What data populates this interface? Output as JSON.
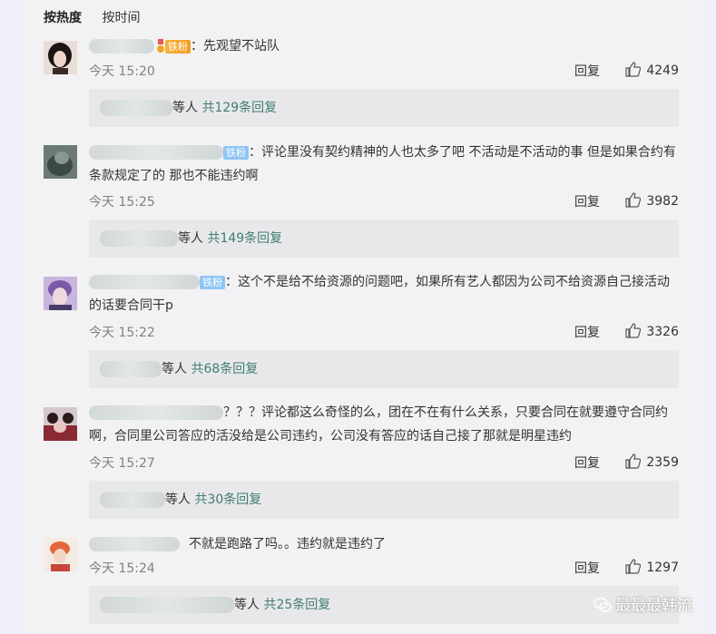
{
  "sort": {
    "hot": "按热度",
    "time": "按时间"
  },
  "comments": [
    {
      "badge": "铁粉",
      "badge_type": "gold",
      "text": "：先观望不站队",
      "time": "今天 15:20",
      "reply": "回复",
      "likes": "4249",
      "reply_suffix": "等人",
      "reply_count": "共129条回复"
    },
    {
      "badge": "铁粉",
      "badge_type": "blue",
      "text": "：评论里没有契约精神的人也太多了吧 不活动是不活动的事 但是如果合约有条款规定了的 那也不能违约啊",
      "time": "今天 15:25",
      "reply": "回复",
      "likes": "3982",
      "reply_suffix": "等人",
      "reply_count": "共149条回复"
    },
    {
      "badge": "铁粉",
      "badge_type": "blue",
      "text": "：这个不是给不给资源的问题吧，如果所有艺人都因为公司不给资源自己接活动的话要合同干p",
      "time": "今天 15:22",
      "reply": "回复",
      "likes": "3326",
      "reply_suffix": "等人",
      "reply_count": "共68条回复"
    },
    {
      "badge": "",
      "badge_type": "",
      "text": "？？？评论都这么奇怪的么，团在不在有什么关系，只要合同在就要遵守合同约啊，合同里公司答应的活没给是公司违约，公司没有答应的话自己接了那就是明星违约",
      "time": "今天 15:27",
      "reply": "回复",
      "likes": "2359",
      "reply_suffix": "等人",
      "reply_count": "共30条回复"
    },
    {
      "badge": "",
      "badge_type": "",
      "text": "不就是跑路了吗。。违约就是违约了",
      "time": "今天 15:24",
      "reply": "回复",
      "likes": "1297",
      "reply_suffix": "等人",
      "reply_count": "共25条回复"
    }
  ],
  "watermark": "最最最韩流"
}
